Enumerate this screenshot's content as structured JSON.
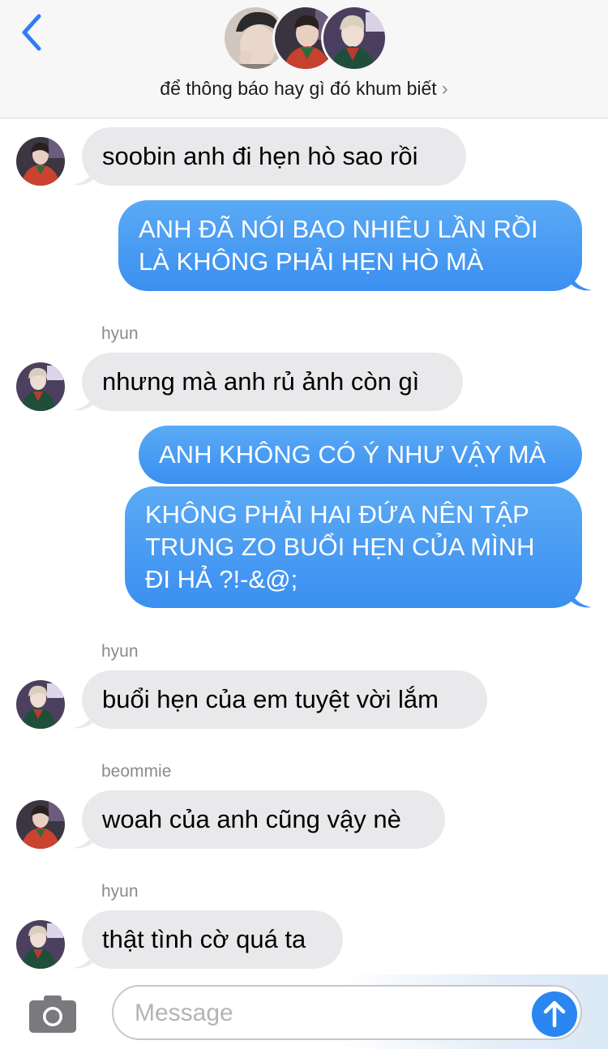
{
  "header": {
    "back_icon": "chevron-left-icon",
    "title": "để thông báo hay gì đó khum biết",
    "title_chevron": "›",
    "avatars": [
      "member-1",
      "member-2",
      "member-3"
    ]
  },
  "colors": {
    "outgoing_bubble": "#3b8ff0",
    "incoming_bubble": "#e9e9eb",
    "accent": "#2a86f0"
  },
  "messages": [
    {
      "direction": "incoming",
      "sender": "",
      "lines": [
        "soobin anh đi hẹn hò sao rồi"
      ],
      "avatar": "avatar-red-jacket"
    },
    {
      "direction": "outgoing",
      "lines": [
        "ANH ĐÃ NÓI BAO NHIÊU LẦN RỒI",
        "LÀ KHÔNG PHẢI HẸN HÒ MÀ"
      ]
    },
    {
      "direction": "incoming",
      "sender": "hyun",
      "lines": [
        "nhưng mà anh rủ ảnh còn gì"
      ],
      "avatar": "avatar-green-jacket"
    },
    {
      "direction": "outgoing",
      "lines": [
        "ANH KHÔNG CÓ Ý NHƯ VẬY MÀ"
      ]
    },
    {
      "direction": "outgoing",
      "lines": [
        "KHÔNG PHẢI HAI ĐỨA NÊN TẬP",
        "TRUNG ZO BUỔI HẸN CỦA MÌNH",
        "ĐI HẢ ?!-&@;"
      ]
    },
    {
      "direction": "incoming",
      "sender": "hyun",
      "lines": [
        "buổi hẹn của em tuyệt vời lắm"
      ],
      "avatar": "avatar-green-jacket"
    },
    {
      "direction": "incoming",
      "sender": "beommie",
      "lines": [
        "woah của anh cũng vậy nè"
      ],
      "avatar": "avatar-red-jacket"
    },
    {
      "direction": "incoming",
      "sender": "hyun",
      "lines": [
        "thật tình cờ quá ta"
      ],
      "avatar": "avatar-green-jacket"
    }
  ],
  "input_bar": {
    "camera_icon": "camera-icon",
    "placeholder": "Message",
    "value": "",
    "send_icon": "arrow-up-icon"
  }
}
